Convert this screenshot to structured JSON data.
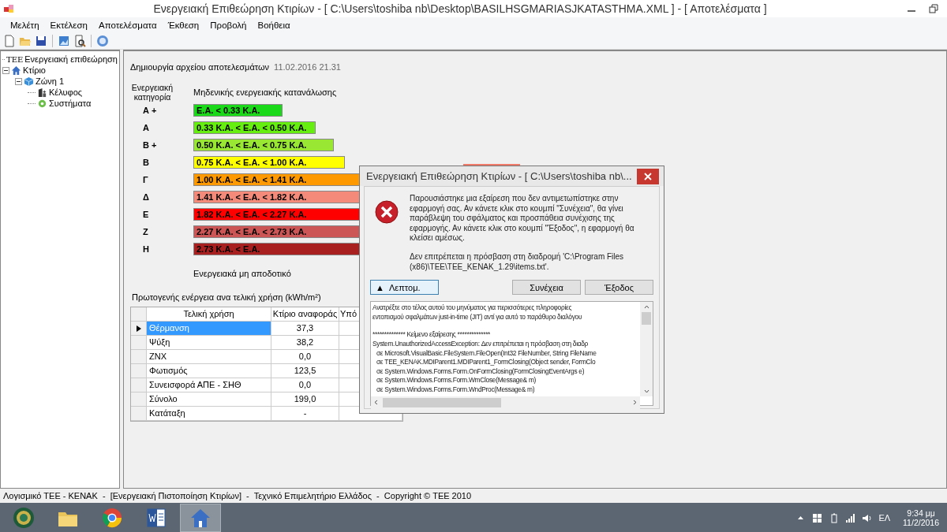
{
  "window": {
    "title": "Ενεργειακή Επιθεώρηση Κτιρίων - [ C:\\Users\\toshiba nb\\Desktop\\BASILHSGMARIASJKATASTHMA.XML ] - [ Αποτελέσματα ]"
  },
  "menu": [
    "Μελέτη",
    "Εκτέλεση",
    "Αποτελέσματα",
    "Έκθεση",
    "Προβολή",
    "Βοήθεια"
  ],
  "tree": [
    {
      "badge": "ΤΕΕ",
      "label": "Ενεργειακή επιθεώρηση",
      "kind": "root"
    },
    {
      "label": "Κτίριο",
      "kind": "building",
      "expanded": true,
      "children": [
        {
          "label": "Ζώνη 1",
          "kind": "zone",
          "expanded": true,
          "children": [
            {
              "label": "Κέλυφος",
              "kind": "shell"
            },
            {
              "label": "Συστήματα",
              "kind": "systems"
            }
          ]
        }
      ]
    }
  ],
  "results": {
    "created_label": "Δημιουργία αρχείου αποτελεσμάτων",
    "created_value": "11.02.2016 21.31",
    "category_header": "Ενεργειακή κατηγορία",
    "top_label": "Μηδενικής ενεργειακής κατανάλωσης",
    "bottom_label": "Ενεργειακά μη αποδοτικό",
    "classes": [
      {
        "grade": "Α +",
        "range": "Ε.Α. < 0.33 Κ.Α.",
        "color": "#19d919"
      },
      {
        "grade": "Α",
        "range": "0.33 Κ.Α. < Ε.Α. < 0.50 Κ.Α.",
        "color": "#66ee11"
      },
      {
        "grade": "Β +",
        "range": "0.50 Κ.Α. < Ε.Α. < 0.75 Κ.Α.",
        "color": "#99e633"
      },
      {
        "grade": "Β",
        "range": "0.75 Κ.Α. < Ε.Α. < 1.00 Κ.Α.",
        "color": "#ffff00"
      },
      {
        "grade": "Γ",
        "range": "1.00 Κ.Α. < Ε.Α. < 1.41 Κ.Α.",
        "color": "#ff9900"
      },
      {
        "grade": "Δ",
        "range": "1.41 Κ.Α. < Ε.Α. < 1.82 Κ.Α.",
        "color": "#f48a7a"
      },
      {
        "grade": "Ε",
        "range": "1.82 Κ.Α. < Ε.Α. < 2.27 Κ.Α.",
        "color": "#ff0000"
      },
      {
        "grade": "Ζ",
        "range": "2.27 Κ.Α. < Ε.Α. < 2.73 Κ.Α.",
        "color": "#cc5555"
      },
      {
        "grade": "Η",
        "range": "2.73 Κ.Α. < Ε.Α.",
        "color": "#a82020"
      }
    ]
  },
  "table": {
    "title": "Πρωτογενής ενέργεια ανα τελική χρήση (kWh/m²)",
    "columns": [
      "Τελική χρήση",
      "Κτίριο αναφοράς",
      "Υπό"
    ],
    "rows": [
      {
        "use": "Θέρμανση",
        "reference": "37,3",
        "selected": true
      },
      {
        "use": "Ψύξη",
        "reference": "38,2",
        "selected": false
      },
      {
        "use": "ΖΝΧ",
        "reference": "0,0",
        "selected": false
      },
      {
        "use": "Φωτισμός",
        "reference": "123,5",
        "selected": false
      },
      {
        "use": "Συνεισφορά ΑΠΕ - ΣΗΘ",
        "reference": "0,0",
        "selected": false
      },
      {
        "use": "Σύνολο",
        "reference": "199,0",
        "selected": false
      },
      {
        "use": "Κατάταξη",
        "reference": "-",
        "selected": false
      }
    ]
  },
  "status_bar": "Λογισμικό ΤΕΕ - ΚΕΝΑΚ  -  [Ενεργειακή Πιστοποίηση Κτιρίων]  -  Τεχνικό Επιμελητήριο Ελλάδος  -  Copyright © ΤΕΕ 2010",
  "dialog": {
    "title": "Ενεργειακή Επιθεώρηση Κτιρίων - [ C:\\Users\\toshiba nb\\...",
    "message": "Παρουσιάστηκε μια εξαίρεση που δεν αντιμετωπίστηκε στην εφαρμογή σας. Αν κάνετε κλικ στο κουμπί \"Συνέχεια\", θα γίνει παράβλεψη του σφάλματος και προσπάθεια συνέχισης της εφαρμογής. Αν κάνετε κλικ στο κουμπί \"Έξοδος\", η εφαρμογή θα κλείσει αμέσως.",
    "detail": "Δεν επιτρέπεται η πρόσβαση στη διαδρομή 'C:\\Program Files (x86)\\TEE\\TEE_KENAK_1.29\\items.txt'.",
    "details_button": {
      "arrow": "▲",
      "label": "Λεπτομ."
    },
    "buttons": [
      "Συνέχεια",
      "Έξοδος"
    ],
    "details_lines": [
      {
        "kind": "text",
        "text": "Ανατρέξτε στο τέλος αυτού του μηνύματος για περισσότερες πληροφορίες"
      },
      {
        "kind": "text",
        "text": "εντοπισμού σφαλμάτων just-in-time (JIT) αντί για αυτό το παράθυρο διαλόγου"
      },
      {
        "kind": "header",
        "text": "************** Κείμενο εξαίρεσης **************"
      },
      {
        "kind": "text",
        "text": "System.UnauthorizedAccessException: Δεν επιτρέπεται η πρόσβαση στη διαδρ"
      },
      {
        "kind": "frame",
        "text": "σε Microsoft.VisualBasic.FileSystem.FileOpen(Int32 FileNumber, String FileName"
      },
      {
        "kind": "frame",
        "text": "σε TEE_KENAK.MDIParent1.MDIParent1_FormClosing(Object sender, FormClo"
      },
      {
        "kind": "frame",
        "text": "σε System.Windows.Forms.Form.OnFormClosing(FormClosingEventArgs e)"
      },
      {
        "kind": "frame",
        "text": "σε System.Windows.Forms.Form.WmClose(Message& m)"
      },
      {
        "kind": "frame",
        "text": "σε System.Windows.Forms.Form.WndProc(Message& m)"
      }
    ]
  },
  "taskbar": {
    "apps": [
      {
        "kind": "orb",
        "selected": false
      },
      {
        "kind": "folder",
        "selected": false
      },
      {
        "kind": "browser",
        "selected": false
      },
      {
        "kind": "word",
        "selected": false
      },
      {
        "kind": "house",
        "selected": true
      }
    ],
    "language": "ΕΛ",
    "time": "9:34 μμ",
    "date": "11/2/2016"
  }
}
